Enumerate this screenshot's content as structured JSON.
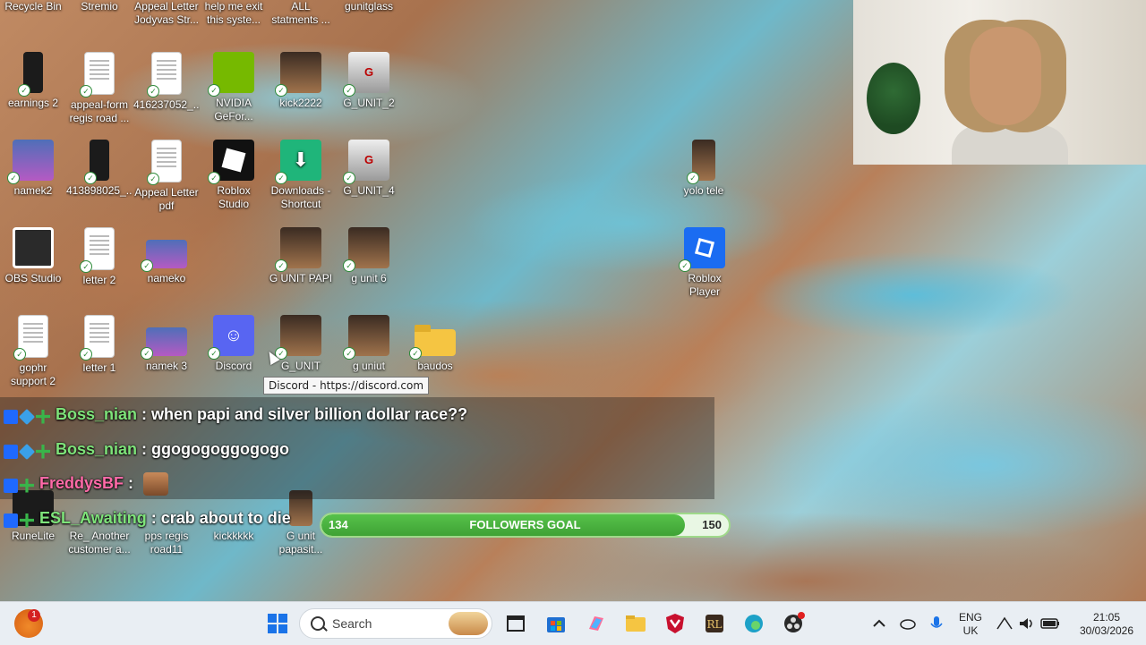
{
  "desktop_icons": [
    {
      "label": "Recycle Bin"
    },
    {
      "label": "Stremio"
    },
    {
      "label": "Appeal Letter Jodyvas Str..."
    },
    {
      "label": "help me exit this syste..."
    },
    {
      "label": "ALL statments ..."
    },
    {
      "label": "gunitglass"
    },
    {
      "label": "earnings 2"
    },
    {
      "label": "appeal-form regis road ..."
    },
    {
      "label": "416237052_..."
    },
    {
      "label": "NVIDIA GeFor..."
    },
    {
      "label": "kick2222"
    },
    {
      "label": "G_UNIT_2"
    },
    {
      "label": "namek2"
    },
    {
      "label": "413898025_..."
    },
    {
      "label": "Appeal Letter pdf"
    },
    {
      "label": "Roblox Studio"
    },
    {
      "label": "Downloads - Shortcut"
    },
    {
      "label": "G_UNIT_4"
    },
    {
      "label": "yolo tele"
    },
    {
      "label": "OBS Studio"
    },
    {
      "label": "letter 2"
    },
    {
      "label": "nameko"
    },
    {
      "label": "G UNIT PAPI"
    },
    {
      "label": "g unit 6"
    },
    {
      "label": "Roblox Player"
    },
    {
      "label": "gophr support 2"
    },
    {
      "label": "letter 1"
    },
    {
      "label": "namek 3"
    },
    {
      "label": "Discord"
    },
    {
      "label": "G_UNIT"
    },
    {
      "label": "g uniut"
    },
    {
      "label": "baudos"
    },
    {
      "label": "RuneLite"
    },
    {
      "label": "Re_ Another customer a..."
    },
    {
      "label": "pps regis road11"
    },
    {
      "label": "kickkkkk"
    },
    {
      "label": "G unit papasit..."
    }
  ],
  "tooltip": "Discord - https://discord.com",
  "chat": [
    {
      "user": "Boss_nian",
      "user_color": "#7ee37a",
      "message": " : when papi and silver billion dollar race??"
    },
    {
      "user": "Boss_nian",
      "user_color": "#7ee37a",
      "message": " : ggogogoggogogo"
    },
    {
      "user": "FreddysBF",
      "user_color": "#ff6aa8",
      "message": " :"
    },
    {
      "user": "ESL_Awaiting",
      "user_color": "#7ee37a",
      "message": " : crab about to die"
    }
  ],
  "followers_goal": {
    "title": "FOLLOWERS GOAL",
    "current": "134",
    "target": "150",
    "progress": 0.893
  },
  "taskbar": {
    "search_placeholder": "Search",
    "notification_count": "1",
    "language_top": "ENG",
    "language_bottom": "UK",
    "time": "21:05",
    "date": "30/03/2026"
  }
}
